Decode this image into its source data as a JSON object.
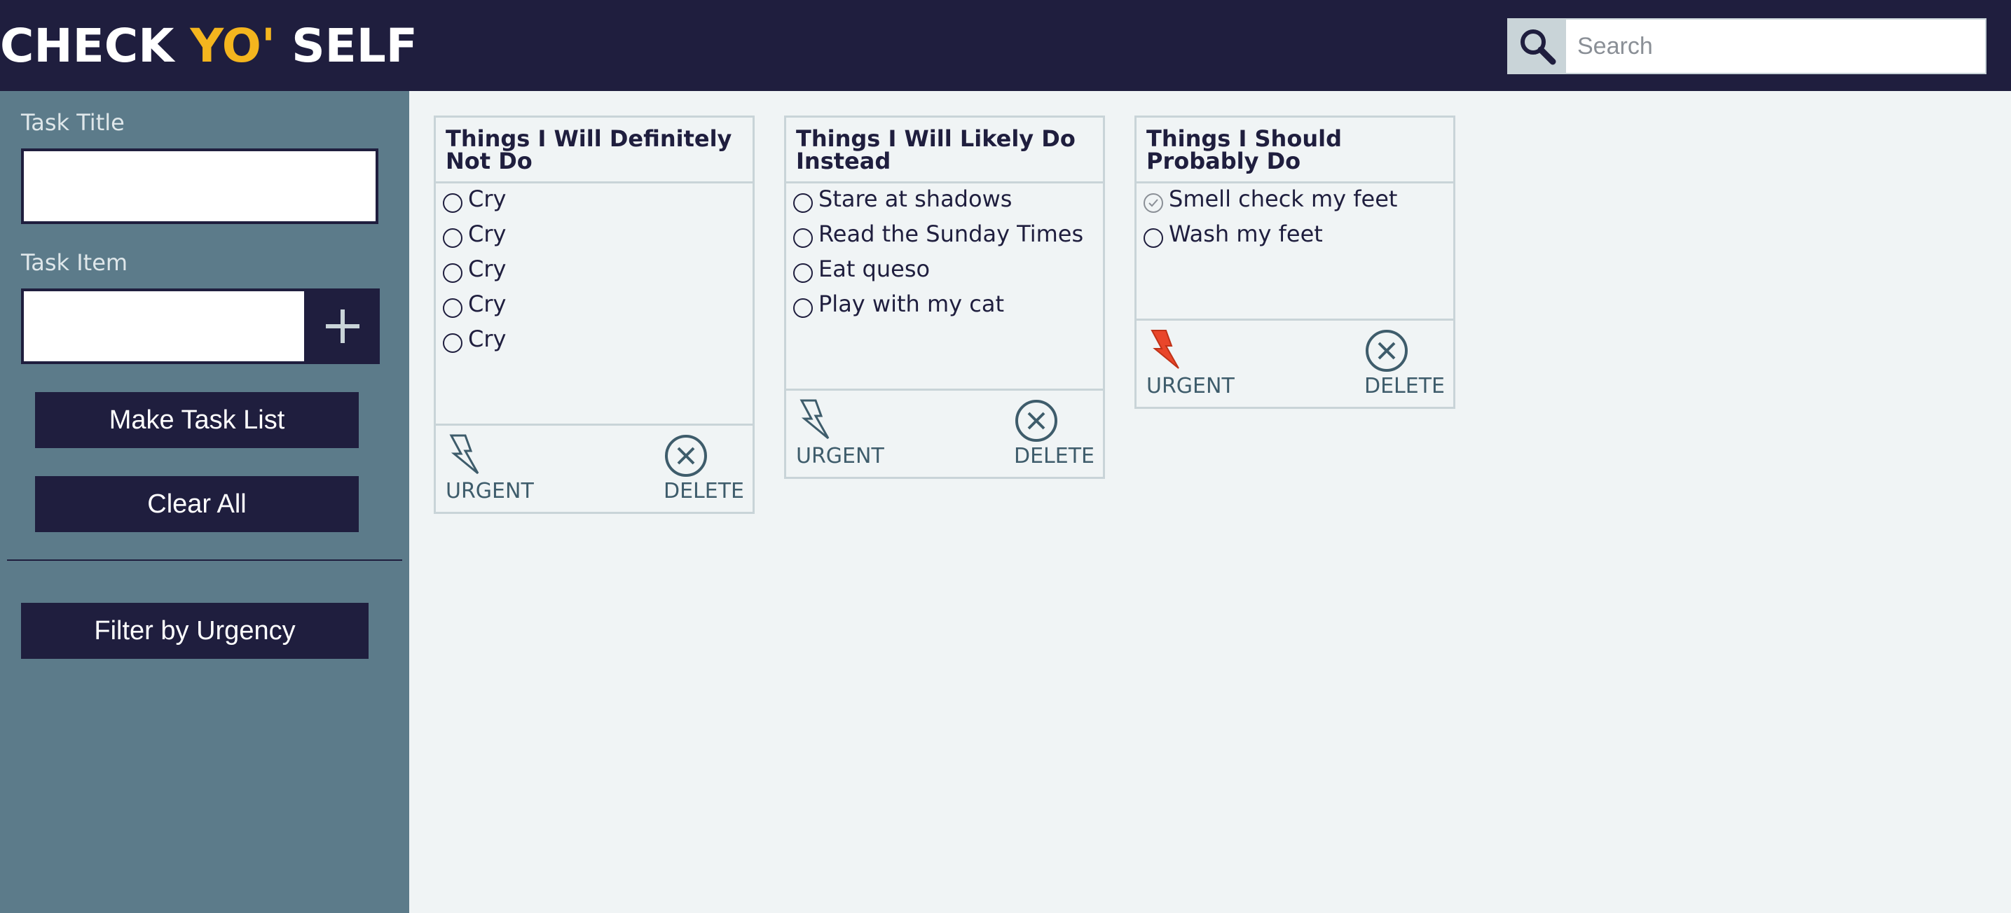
{
  "header": {
    "logo_part1": "CHECK ",
    "logo_accent": "YO'",
    "logo_part2": " SELF",
    "search_placeholder": "Search",
    "search_icon": "magnifier-icon"
  },
  "sidebar": {
    "task_title_label": "Task Title",
    "task_title_value": "",
    "task_item_label": "Task Item",
    "task_item_value": "",
    "add_icon": "plus-icon",
    "make_task_list_label": "Make Task List",
    "clear_all_label": "Clear All",
    "filter_label": "Filter by Urgency"
  },
  "cards": [
    {
      "title": "Things I Will Definitely Not Do",
      "items": [
        {
          "text": "Cry",
          "checked": false
        },
        {
          "text": "Cry",
          "checked": false
        },
        {
          "text": "Cry",
          "checked": false
        },
        {
          "text": "Cry",
          "checked": false
        },
        {
          "text": "Cry",
          "checked": false
        }
      ],
      "urgent": false,
      "urgent_label": "URGENT",
      "delete_label": "DELETE"
    },
    {
      "title": "Things I Will Likely Do Instead",
      "items": [
        {
          "text": "Stare at shadows",
          "checked": false
        },
        {
          "text": "Read the Sunday Times",
          "checked": false
        },
        {
          "text": "Eat queso",
          "checked": false
        },
        {
          "text": "Play with my cat",
          "checked": false
        }
      ],
      "urgent": false,
      "urgent_label": "URGENT",
      "delete_label": "DELETE"
    },
    {
      "title": "Things I Should Probably Do",
      "items": [
        {
          "text": "Smell check my feet",
          "checked": true
        },
        {
          "text": "Wash my feet",
          "checked": false
        }
      ],
      "urgent": true,
      "urgent_label": "URGENT",
      "delete_label": "DELETE"
    }
  ],
  "colors": {
    "navy": "#1f1e3e",
    "accent_yellow": "#f4b51e",
    "sidebar_slate": "#5c7b8a",
    "card_border": "#c9d4d8",
    "urgent_active": "#e9462a",
    "icon_slate": "#3e5c6b"
  }
}
